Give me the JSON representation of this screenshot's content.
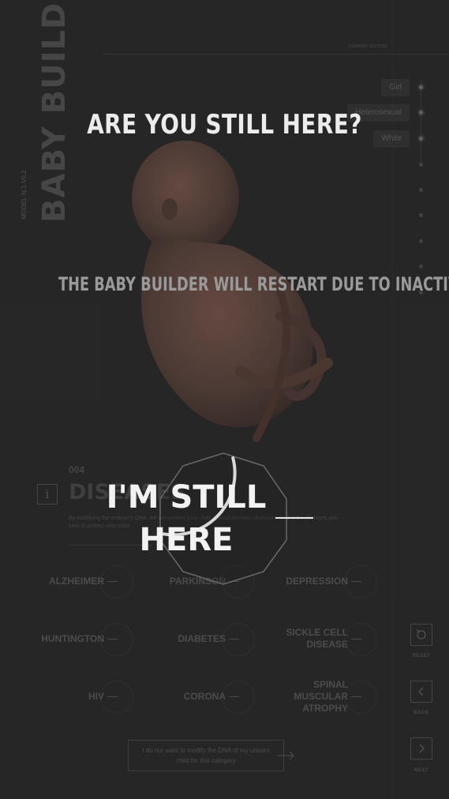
{
  "app": {
    "title": "BABY BUILDER",
    "model_label": "MODEL N.1-V0.2",
    "top_label": "CURRENT SECTION"
  },
  "selections": [
    {
      "label": "Girl"
    },
    {
      "label": "Heterosexual"
    },
    {
      "label": "White"
    }
  ],
  "section": {
    "number": "004",
    "title": "DISEASES",
    "description": "By modifying the embryo's DNA, we can protect your child against common diseases. Select the diseases you wish to protect your child",
    "info_icon": "info-icon"
  },
  "diseases": [
    {
      "label": "ALZHEIMER"
    },
    {
      "label": "PARKINSON"
    },
    {
      "label": "DEPRESSION"
    },
    {
      "label": "HUNTINGTON"
    },
    {
      "label": "DIABETES"
    },
    {
      "label": "SICKLE CELL DISEASE"
    },
    {
      "label": "HIV"
    },
    {
      "label": "CORONA"
    },
    {
      "label": "SPINAL MUSCULAR ATROPHY"
    }
  ],
  "skip_option": "I do not want to modify the DNA of my unborn child for this category",
  "controls": {
    "reset": "RESET",
    "back": "BACK",
    "next": "NEXT"
  },
  "modal": {
    "title": "ARE YOU STILL HERE?",
    "message": "THE BABY BUILDER WILL RESTART DUE TO INACTIVITY",
    "button": "I'M STILL HERE",
    "countdown_remaining_fraction": 0.35
  },
  "colors": {
    "background": "#2a2a2a",
    "modal_text": "#ececec",
    "accent": "#e6e6e6"
  }
}
